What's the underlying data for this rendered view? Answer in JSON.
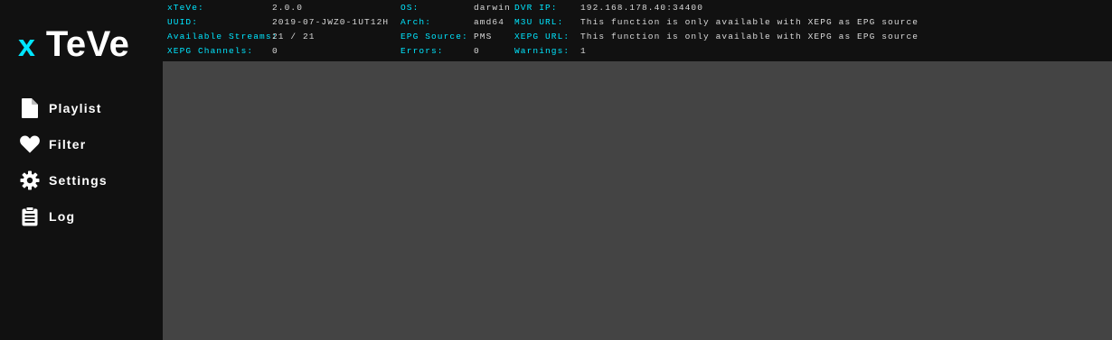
{
  "logo": {
    "mark": "x",
    "name": "TeVe"
  },
  "nav": {
    "items": [
      {
        "label": "Playlist",
        "icon": "file-icon"
      },
      {
        "label": "Filter",
        "icon": "heart-icon"
      },
      {
        "label": "Settings",
        "icon": "gear-icon"
      },
      {
        "label": "Log",
        "icon": "clipboard-icon"
      }
    ]
  },
  "info": {
    "xteve_label": "xTeVe:",
    "xteve_value": "2.0.0",
    "uuid_label": "UUID:",
    "uuid_value": "2019-07-JWZ0-1UT12H",
    "streams_label": "Available Streams:",
    "streams_value": "21 / 21",
    "channels_label": "XEPG Channels:",
    "channels_value": "0",
    "os_label": "OS:",
    "os_value": "darwin",
    "arch_label": "Arch:",
    "arch_value": "amd64",
    "epg_source_label": "EPG Source:",
    "epg_source_value": "PMS",
    "errors_label": "Errors:",
    "errors_value": "0",
    "dvr_ip_label": "DVR IP:",
    "dvr_ip_value": "192.168.178.40:34400",
    "m3u_url_label": "M3U URL:",
    "m3u_url_value": "This function is only available with XEPG as EPG source",
    "xepg_url_label": "XEPG URL:",
    "xepg_url_value": "This function is only available with XEPG as EPG source",
    "warnings_label": "Warnings:",
    "warnings_value": "1"
  },
  "colors": {
    "accent": "#00e6ff",
    "sidebar_bg": "#111111",
    "content_bg": "#444444",
    "text": "#ffffff",
    "value_text": "#d9d9d9"
  }
}
